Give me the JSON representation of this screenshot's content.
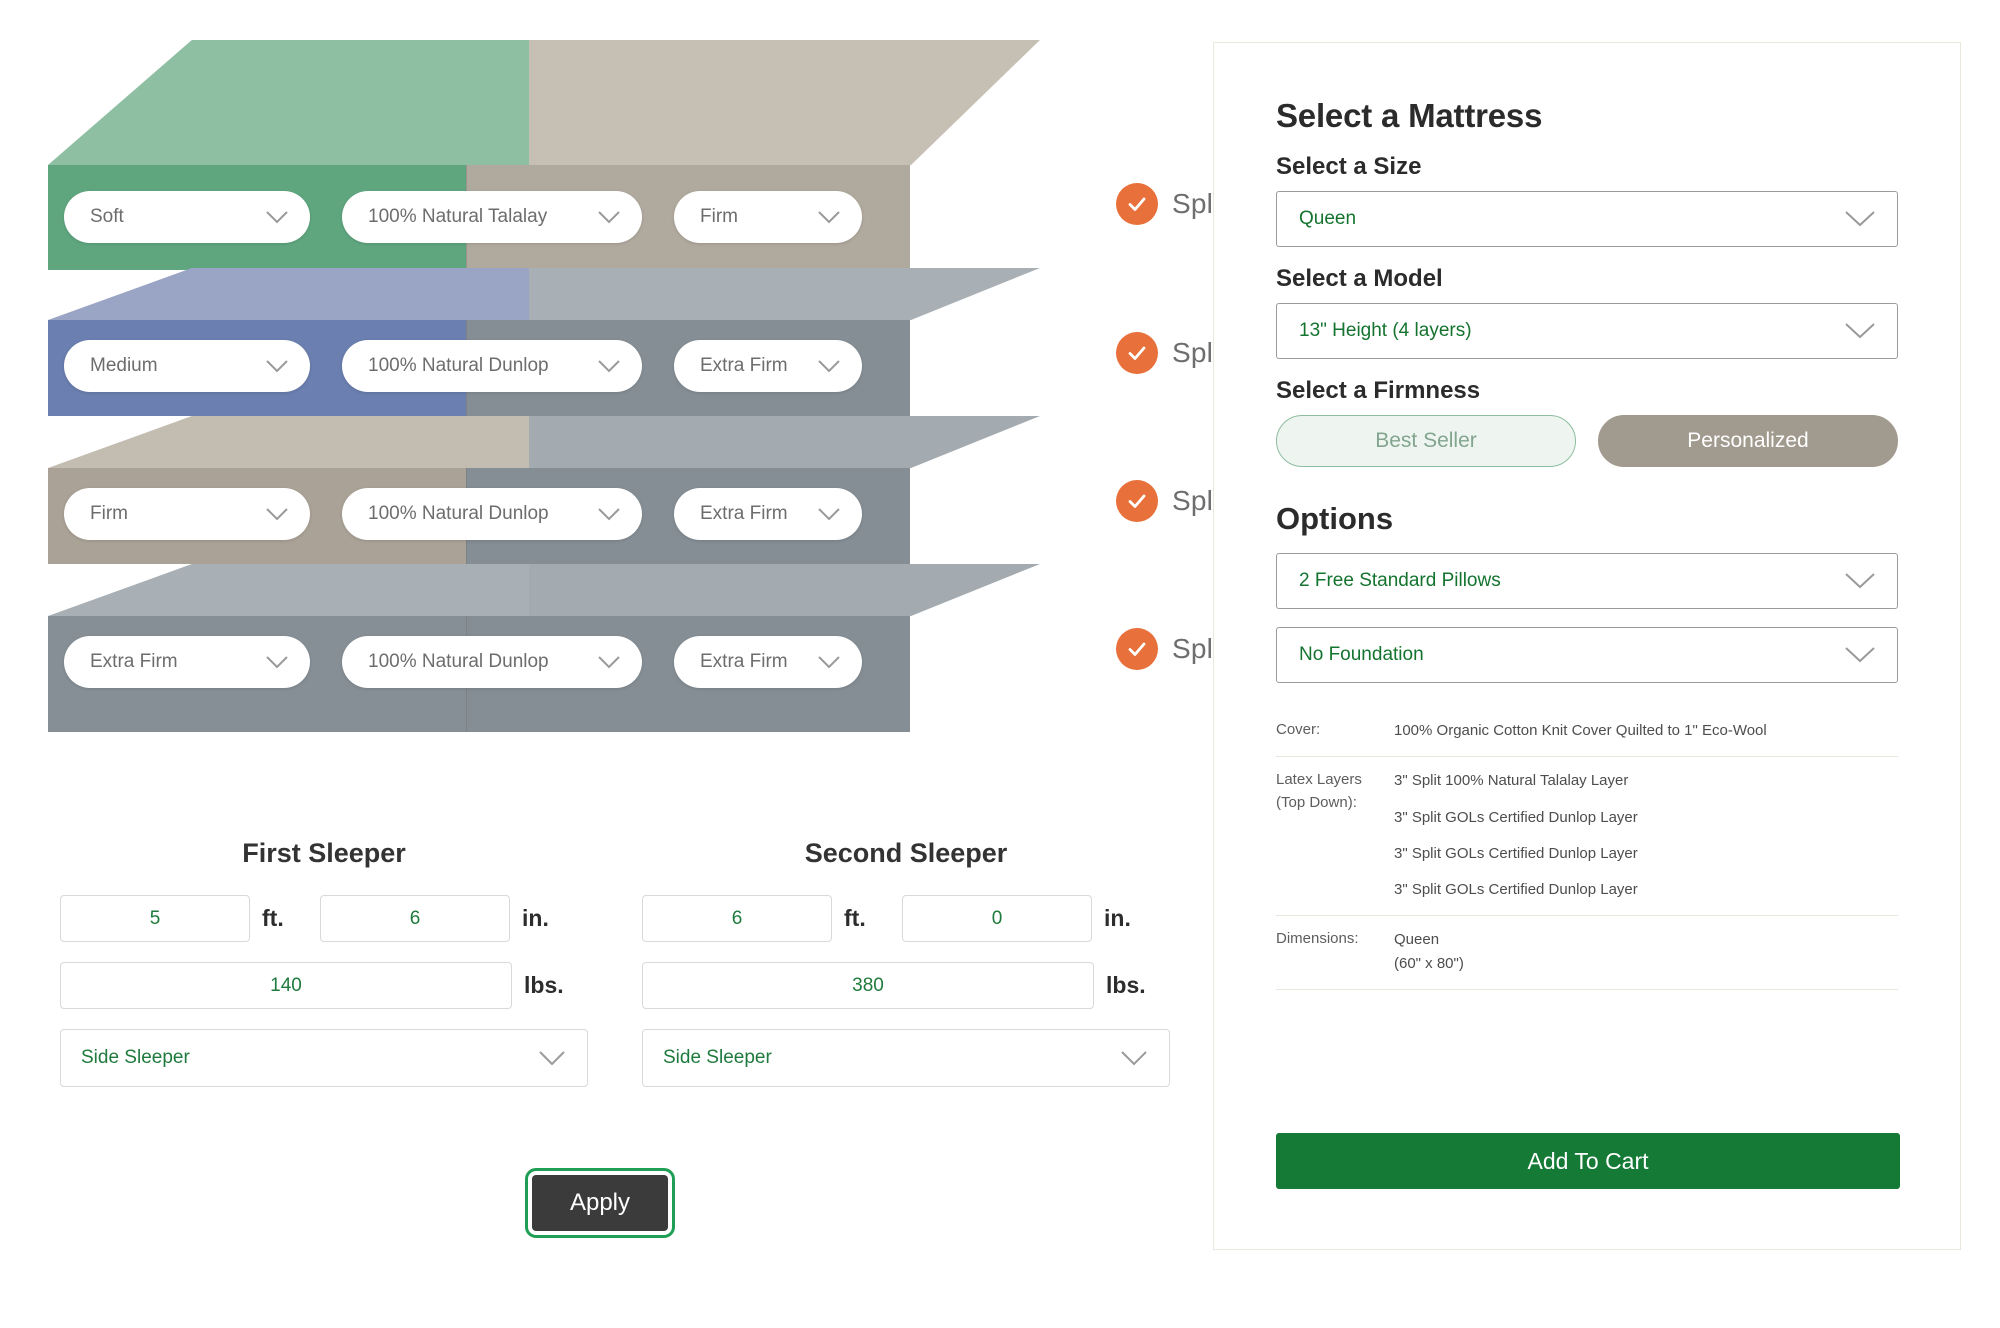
{
  "colors": {
    "accent_green": "#14742f",
    "cart_green": "#157a36",
    "split_orange": "#E8703A",
    "apply_dark": "#3b3b3b",
    "apply_focus_ring": "#1f9e55",
    "panel_border": "#ece7dc",
    "personalized_tan": "#a19a8e"
  },
  "builder": {
    "layers": [
      {
        "firmness_left": "Soft",
        "material": "100% Natural Talalay",
        "firmness_right": "Firm",
        "split_label": "Split",
        "split_checked": true,
        "color_left_top": "#8fbfa3",
        "color_left_front": "#5fa67f",
        "color_right_top": "#c6bfb4",
        "color_right_front": "#b0a99e"
      },
      {
        "firmness_left": "Medium",
        "material": "100% Natural Dunlop",
        "firmness_right": "Extra Firm",
        "split_label": "Split",
        "split_checked": true,
        "color_left_top": "#9aa4c4",
        "color_left_front": "#6b7fb0",
        "color_right_top": "#a9b0b5",
        "color_right_front": "#848e94"
      },
      {
        "firmness_left": "Firm",
        "material": "100% Natural Dunlop",
        "firmness_right": "Extra Firm",
        "split_label": "Split",
        "split_checked": true,
        "color_left_top": "#c3bcb1",
        "color_left_front": "#aaa296",
        "color_right_top": "#a3abb0",
        "color_right_front": "#848e94"
      },
      {
        "firmness_left": "Extra Firm",
        "material": "100% Natural Dunlop",
        "firmness_right": "Extra Firm",
        "split_label": "Split",
        "split_checked": true,
        "color_left_top": "#a8b0b5",
        "color_left_front": "#858f95",
        "color_right_top": "#a3abb0",
        "color_right_front": "#848e94"
      }
    ],
    "apply_label": "Apply",
    "sleepers": [
      {
        "title": "First Sleeper",
        "height_ft": "5",
        "height_in": "6",
        "weight": "140",
        "position": "Side Sleeper",
        "unit_ft": "ft.",
        "unit_in": "in.",
        "unit_lbs": "lbs."
      },
      {
        "title": "Second Sleeper",
        "height_ft": "6",
        "height_in": "0",
        "weight": "380",
        "position": "Side Sleeper",
        "unit_ft": "ft.",
        "unit_in": "in.",
        "unit_lbs": "lbs."
      }
    ]
  },
  "panel": {
    "title": "Select a Mattress",
    "size_label": "Select a Size",
    "size_value": "Queen",
    "model_label": "Select a Model",
    "model_value": "13\" Height (4 layers)",
    "firmness_label": "Select a Firmness",
    "firmness_best_seller": "Best Seller",
    "firmness_personalized": "Personalized",
    "options_title": "Options",
    "option_pillows": "2 Free Standard Pillows",
    "option_foundation": "No Foundation",
    "spec": {
      "cover_key": "Cover:",
      "cover_value": "100% Organic Cotton Knit Cover Quilted to 1\" Eco-Wool",
      "latex_key_line1": "Latex Layers",
      "latex_key_line2": "(Top Down):",
      "latex_values": [
        "3\" Split 100% Natural Talalay Layer",
        "3\" Split GOLs Certified Dunlop Layer",
        "3\" Split GOLs Certified Dunlop Layer",
        "3\" Split GOLs Certified Dunlop Layer"
      ],
      "dimensions_key": "Dimensions:",
      "dimensions_line1": "Queen",
      "dimensions_line2": "(60\" x 80\")"
    },
    "add_to_cart": "Add To Cart"
  }
}
